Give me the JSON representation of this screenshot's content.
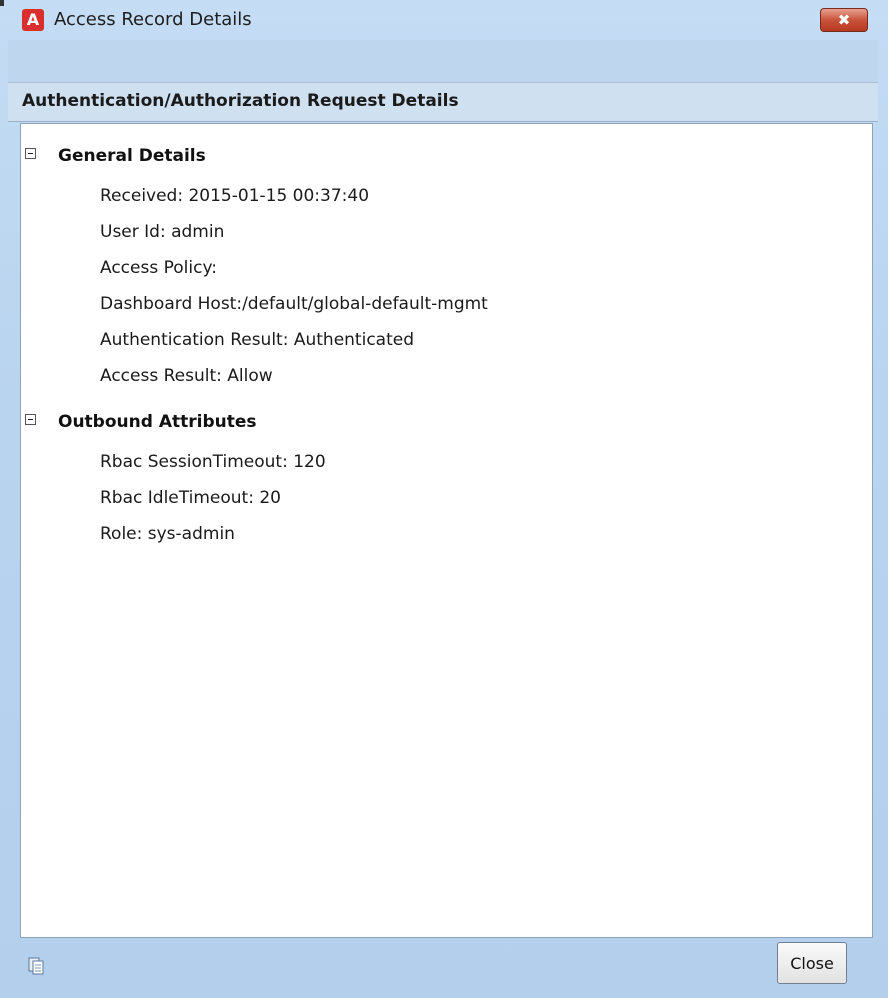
{
  "window": {
    "title": "Access Record Details",
    "close_glyph": "✖",
    "app_icon_letter": "A",
    "app_icon_color": "#d9302f"
  },
  "header": {
    "title": "Authentication/Authorization Request Details"
  },
  "sections": [
    {
      "title": "General Details",
      "expanded": true,
      "rows": [
        "Received:  2015-01-15 00:37:40",
        "User Id: admin",
        "Access Policy:",
        "Dashboard Host:/default/global-default-mgmt",
        "Authentication Result: Authenticated",
        "Access Result: Allow"
      ]
    },
    {
      "title": "Outbound Attributes",
      "expanded": true,
      "rows": [
        "Rbac SessionTimeout: 120",
        "Rbac IdleTimeout: 20",
        "Role: sys-admin"
      ]
    }
  ],
  "footer": {
    "copy_icon": "clipboard-icon",
    "close_label": "Close"
  }
}
